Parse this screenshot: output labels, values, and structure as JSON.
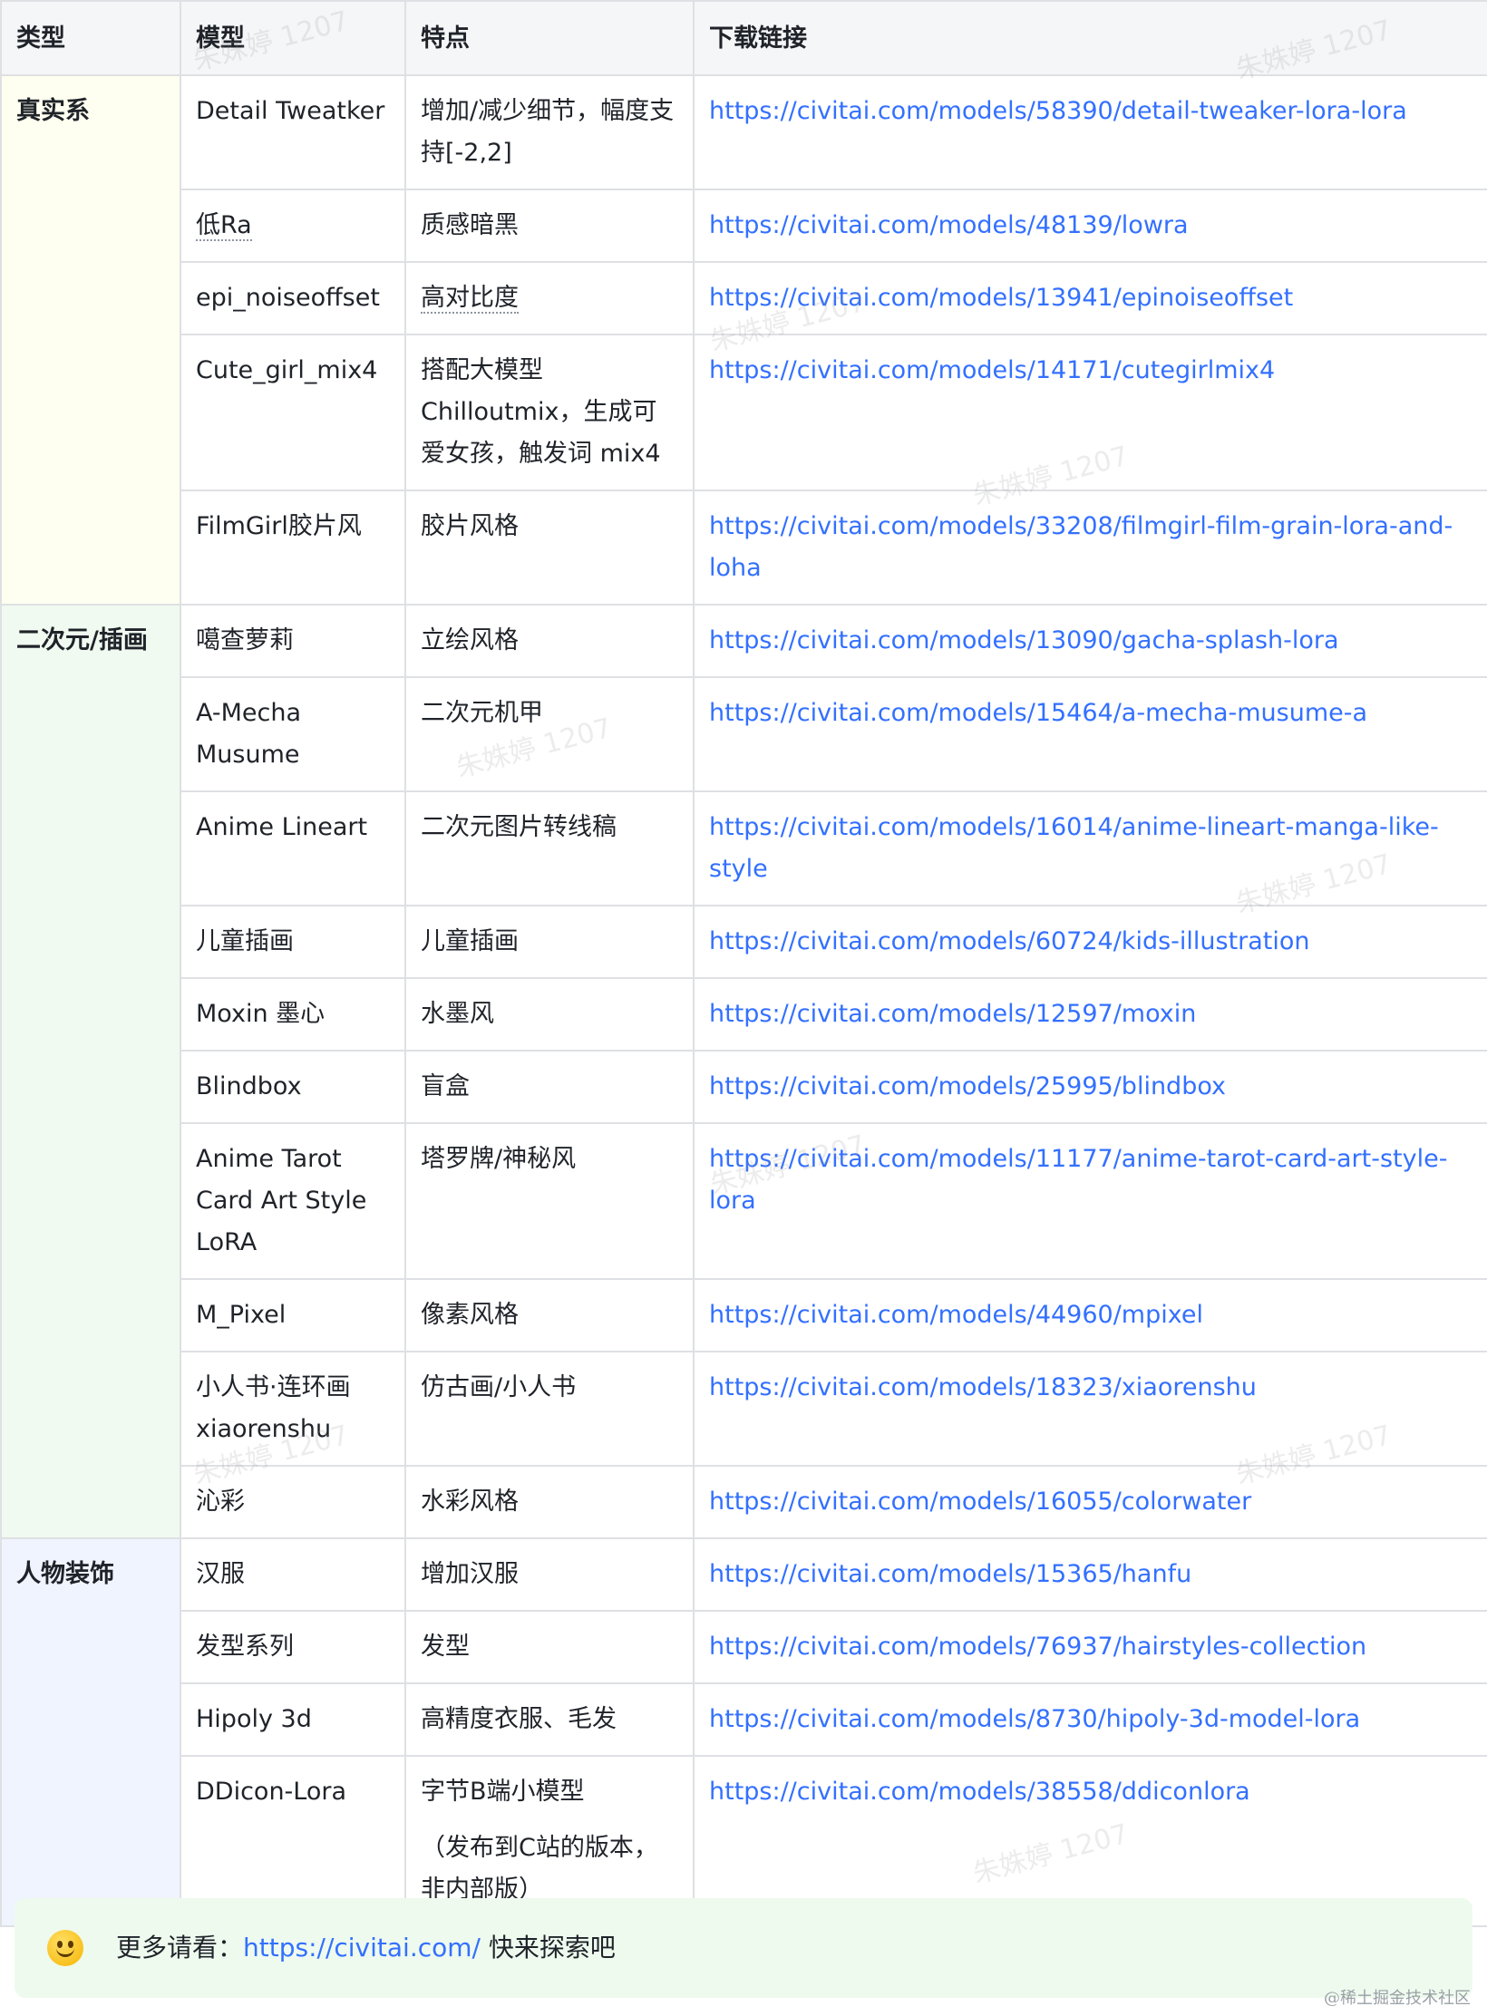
{
  "table": {
    "headers": [
      "类型",
      "模型",
      "特点",
      "下载链接"
    ],
    "categories": {
      "real": "真实系",
      "anime": "二次元/插画",
      "person": "人物装饰"
    },
    "rows": [
      {
        "model": "Detail Tweatker",
        "feature": "增加/减少细节，幅度支持[-2,2]",
        "link": "https://civitai.com/models/58390/detail-tweaker-lora-lora"
      },
      {
        "model": "低Ra",
        "feature": "质感暗黑",
        "link": "https://civitai.com/models/48139/lowra"
      },
      {
        "model": "epi_noiseoffset",
        "feature": "高对比度",
        "link": "https://civitai.com/models/13941/epinoiseoffset"
      },
      {
        "model": "Cute_girl_mix4",
        "feature": "搭配大模型Chilloutmix，生成可爱女孩，触发词 mix4",
        "link": "https://civitai.com/models/14171/cutegirlmix4"
      },
      {
        "model": "FilmGirl胶片风",
        "feature": "胶片风格",
        "link": "https://civitai.com/models/33208/filmgirl-film-grain-lora-and-loha"
      },
      {
        "model": "噶查萝莉",
        "feature": "立绘风格",
        "link": "https://civitai.com/models/13090/gacha-splash-lora"
      },
      {
        "model": "A-Mecha Musume",
        "feature": "二次元机甲",
        "link": "https://civitai.com/models/15464/a-mecha-musume-a"
      },
      {
        "model": "Anime Lineart",
        "feature": "二次元图片转线稿",
        "link": "https://civitai.com/models/16014/anime-lineart-manga-like-style"
      },
      {
        "model": "儿童插画",
        "feature": "儿童插画",
        "link": "https://civitai.com/models/60724/kids-illustration"
      },
      {
        "model": "Moxin 墨心",
        "feature": "水墨风",
        "link": "https://civitai.com/models/12597/moxin"
      },
      {
        "model": "Blindbox",
        "feature": "盲盒",
        "link": "https://civitai.com/models/25995/blindbox"
      },
      {
        "model": "Anime Tarot Card Art Style LoRA",
        "feature": "塔罗牌/神秘风",
        "link": "https://civitai.com/models/11177/anime-tarot-card-art-style-lora"
      },
      {
        "model": "M_Pixel",
        "feature": "像素风格",
        "link": "https://civitai.com/models/44960/mpixel"
      },
      {
        "model": "小人书·连环画 xiaorenshu",
        "feature": "仿古画/小人书",
        "link": "https://civitai.com/models/18323/xiaorenshu"
      },
      {
        "model": "沁彩",
        "feature": "水彩风格",
        "link": "https://civitai.com/models/16055/colorwater"
      },
      {
        "model": "汉服",
        "feature": "增加汉服",
        "link": "https://civitai.com/models/15365/hanfu"
      },
      {
        "model": "发型系列",
        "feature": "发型",
        "link": "https://civitai.com/models/76937/hairstyles-collection"
      },
      {
        "model": "Hipoly 3d",
        "feature": "高精度衣服、毛发",
        "link": "https://civitai.com/models/8730/hipoly-3d-model-lora"
      },
      {
        "model": "DDicon-Lora",
        "feature": "字节B端小模型",
        "feature2": "（发布到C站的版本，非内部版）",
        "link": "https://civitai.com/models/38558/ddiconlora"
      }
    ]
  },
  "note": {
    "icon": "smile-emoji-icon",
    "prefix": "更多请看：",
    "link": "https://civitai.com/",
    "suffix": " 快来探索吧"
  },
  "watermark": "朱姝婷 1207",
  "credit": "@稀土掘金技术社区",
  "colors": {
    "link": "#3370ff",
    "border": "#dee0e3",
    "real_bg": "#fefff0",
    "anime_bg": "#f0faf0",
    "person_bg": "#f0f4ff",
    "note_bg": "#eefaee"
  }
}
